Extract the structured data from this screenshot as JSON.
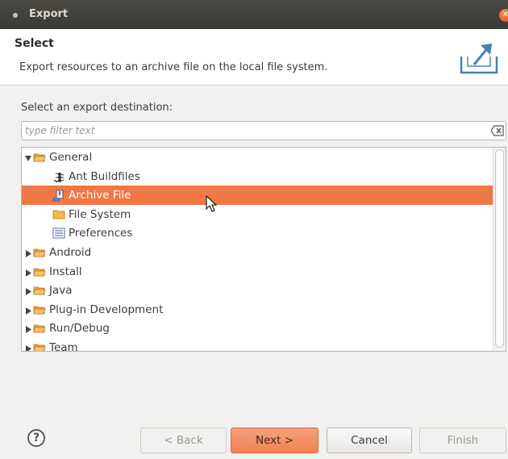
{
  "window": {
    "title": "Export"
  },
  "header": {
    "title": "Select",
    "description": "Export resources to an archive file on the local file system."
  },
  "destination_label": "Select an export destination:",
  "filter": {
    "placeholder": "type filter text",
    "value": ""
  },
  "tree": {
    "items": [
      {
        "label": "General",
        "expanded": true,
        "level": 0,
        "icon": "folder-open-icon"
      },
      {
        "label": "Ant Buildfiles",
        "level": 1,
        "icon": "ant-icon"
      },
      {
        "label": "Archive File",
        "level": 1,
        "icon": "archive-icon",
        "selected": true
      },
      {
        "label": "File System",
        "level": 1,
        "icon": "folder-icon"
      },
      {
        "label": "Preferences",
        "level": 1,
        "icon": "preferences-icon"
      },
      {
        "label": "Android",
        "expanded": false,
        "level": 0,
        "icon": "folder-open-icon"
      },
      {
        "label": "Install",
        "expanded": false,
        "level": 0,
        "icon": "folder-open-icon"
      },
      {
        "label": "Java",
        "expanded": false,
        "level": 0,
        "icon": "folder-open-icon"
      },
      {
        "label": "Plug-in Development",
        "expanded": false,
        "level": 0,
        "icon": "folder-open-icon"
      },
      {
        "label": "Run/Debug",
        "expanded": false,
        "level": 0,
        "icon": "folder-open-icon"
      },
      {
        "label": "Team",
        "expanded": false,
        "level": 0,
        "icon": "folder-open-icon"
      }
    ]
  },
  "buttons": {
    "back": "< Back",
    "next": "Next >",
    "cancel": "Cancel",
    "finish": "Finish",
    "help": "?"
  },
  "colors": {
    "selection": "#f07746",
    "accent": "#ef8253",
    "titlebar": "#3f3e3a"
  }
}
